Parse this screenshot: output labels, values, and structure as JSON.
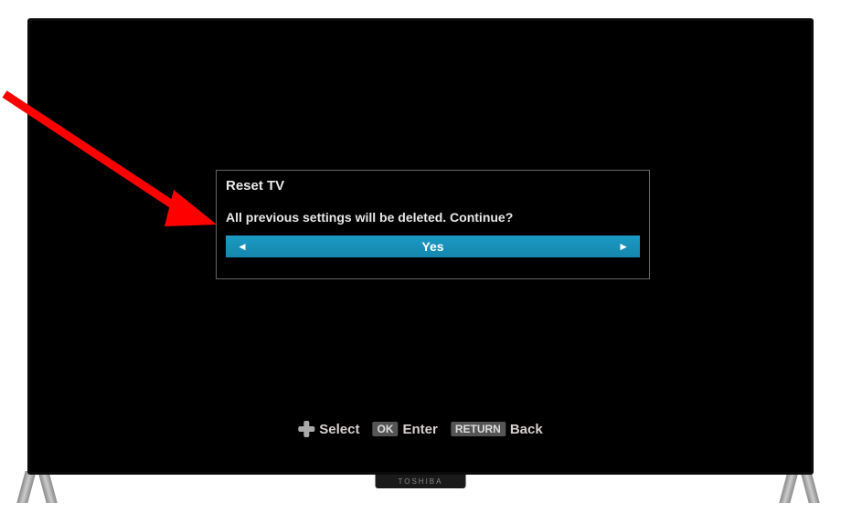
{
  "dialog": {
    "title": "Reset TV",
    "message": "All previous settings will be deleted. Continue?",
    "selected_option": "Yes"
  },
  "hints": {
    "select_label": "Select",
    "enter_label": "Enter",
    "back_label": "Back",
    "ok_badge": "OK",
    "return_badge": "RETURN"
  },
  "brand": "TOSHIBA"
}
